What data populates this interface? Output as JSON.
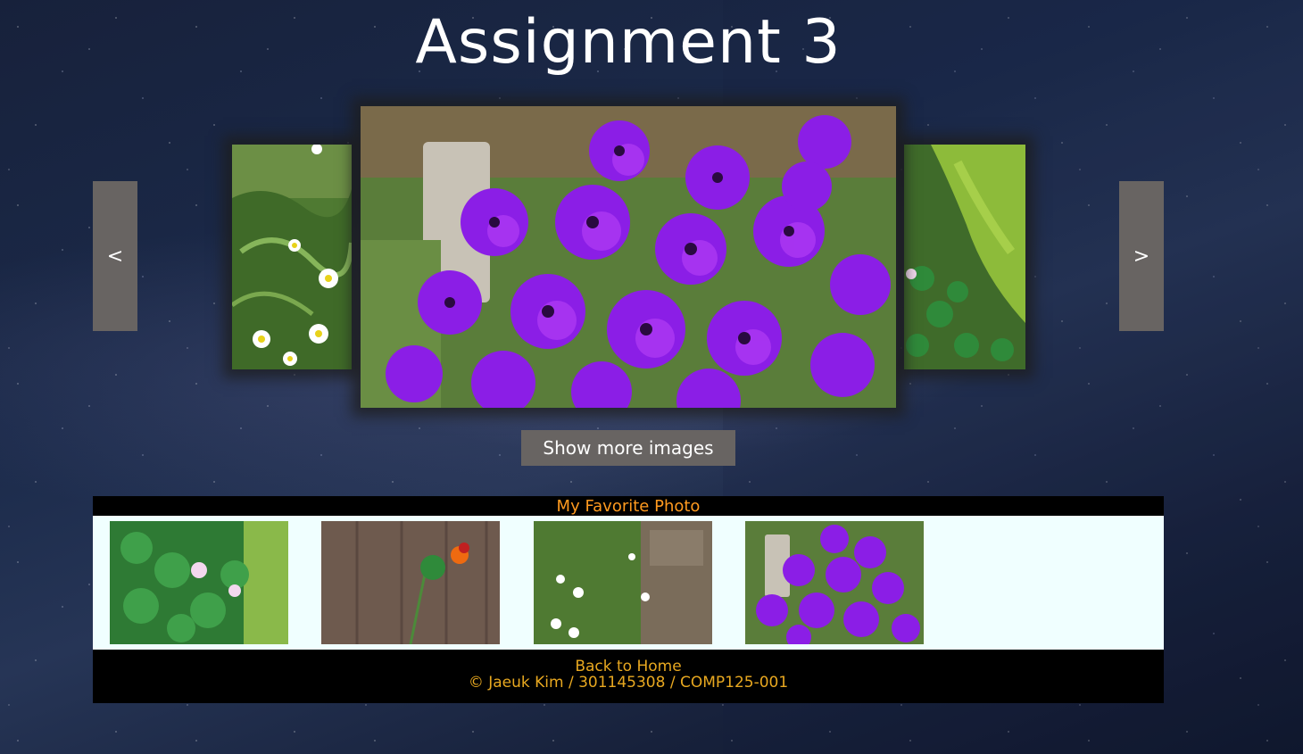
{
  "page": {
    "title": "Assignment 3"
  },
  "carousel": {
    "prev_label": "<",
    "next_label": ">",
    "show_more_label": "Show more images"
  },
  "favorites": {
    "heading": "My Favorite Photo"
  },
  "footer": {
    "home_link": "Back to Home",
    "copyright": "©  Jaeuk Kim / 301145308 / COMP125-001"
  },
  "colors": {
    "button_bg": "#686462",
    "accent": "#ff9a1f",
    "footer_text": "#e8a820",
    "strip_bg": "#f0ffff"
  }
}
